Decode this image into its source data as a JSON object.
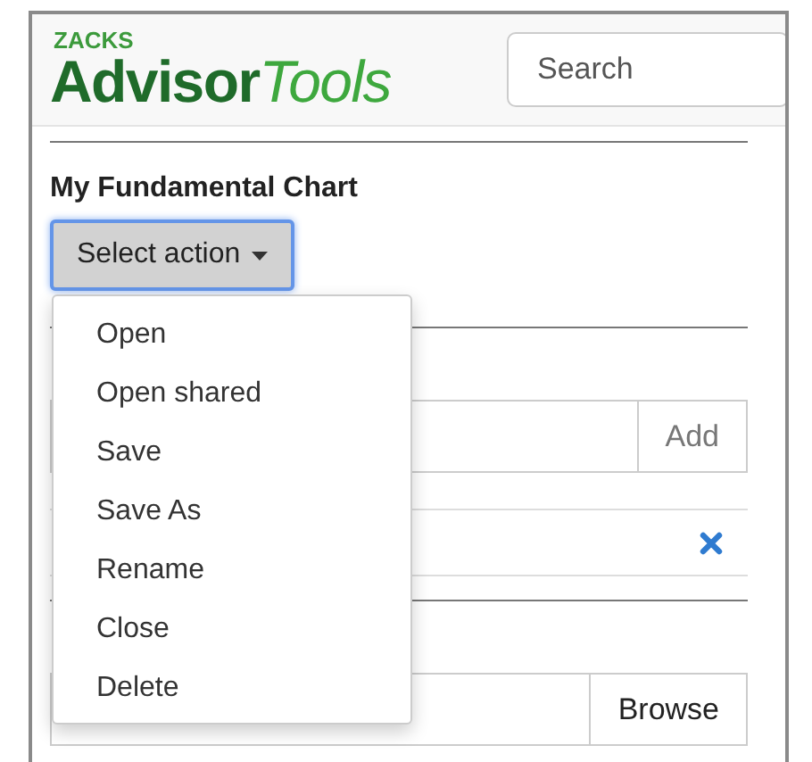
{
  "logo": {
    "brand": "ZACKS",
    "main": "Advisor",
    "accent": "Tools"
  },
  "search": {
    "placeholder": "Search"
  },
  "panel_title": "My Fundamental Chart",
  "action_button": {
    "label": "Select action",
    "focused": true
  },
  "action_menu": {
    "expanded": true,
    "items": [
      {
        "label": "Open"
      },
      {
        "label": "Open shared"
      },
      {
        "label": "Save"
      },
      {
        "label": "Save As"
      },
      {
        "label": "Rename"
      },
      {
        "label": "Close"
      },
      {
        "label": "Delete"
      }
    ]
  },
  "add_button": "Add",
  "browse_button": "Browse"
}
